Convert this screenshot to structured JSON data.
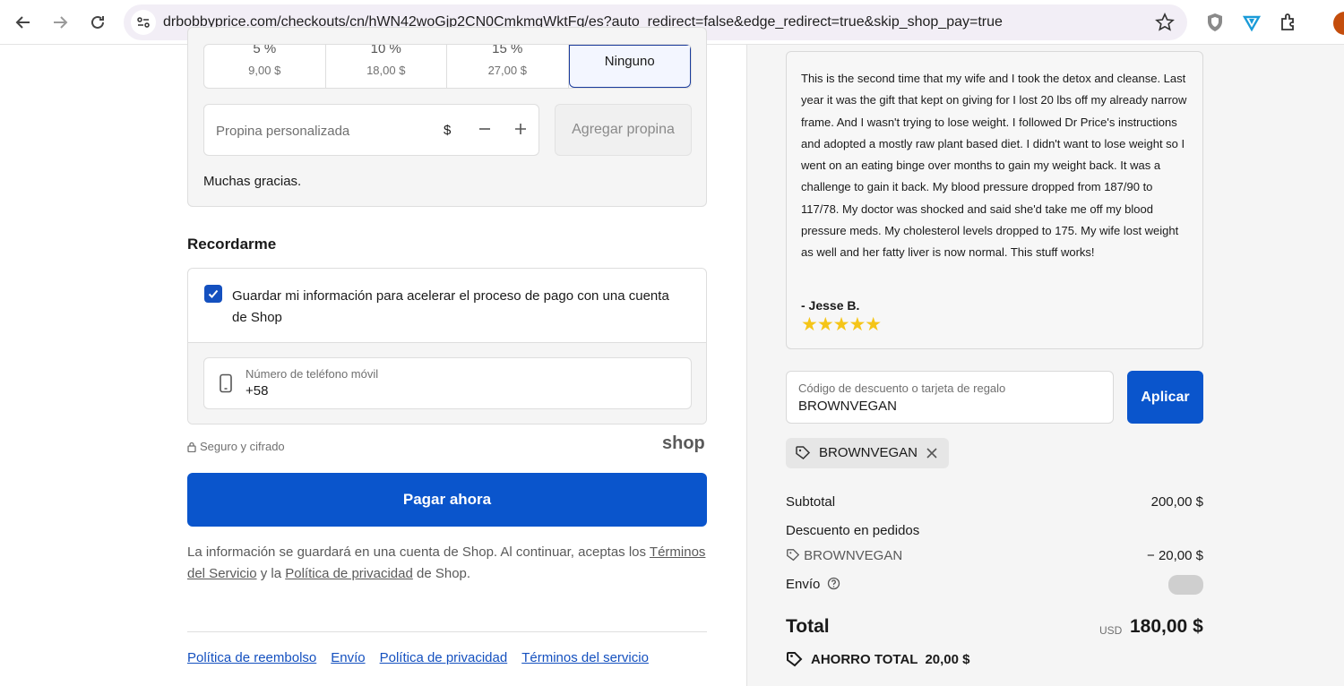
{
  "browser": {
    "url": "drbobbyprice.com/checkouts/cn/hWN42woGjp2CN0CmkmgWktFq/es?auto_redirect=false&edge_redirect=true&skip_shop_pay=true"
  },
  "tip": {
    "options": [
      {
        "pct": "5 %",
        "amount": "9,00 $"
      },
      {
        "pct": "10 %",
        "amount": "18,00 $"
      },
      {
        "pct": "15 %",
        "amount": "27,00 $"
      }
    ],
    "none_label": "Ninguno",
    "custom_placeholder": "Propina personalizada",
    "currency": "$",
    "add_label": "Agregar propina",
    "thanks": "Muchas gracias."
  },
  "remember": {
    "title": "Recordarme",
    "checkbox_label": "Guardar mi información para acelerar el proceso de pago con una cuenta de Shop",
    "phone_label": "Número de teléfono móvil",
    "phone_value": "+58",
    "secure": "Seguro y cifrado",
    "shop_logo": "shop"
  },
  "pay_label": "Pagar ahora",
  "disclaimer": {
    "text1": "La información se guardará en una cuenta de Shop. Al continuar, aceptas los ",
    "terms": "Términos del Servicio",
    "text2": " y la ",
    "privacy": "Política de privacidad",
    "text3": " de Shop."
  },
  "footer": {
    "refund": "Política de reembolso",
    "shipping": "Envío",
    "privacy": "Política de privacidad",
    "terms": "Términos del servicio"
  },
  "review": {
    "text": "This is the second time that my wife and I took the detox and cleanse. Last year it was the gift that kept on giving for I lost 20 lbs off my already narrow frame. And I wasn't trying to lose weight. I followed Dr Price's instructions and adopted a mostly raw plant based diet. I didn't want to lose weight so I went on an eating binge over months to gain my weight back. It was a challenge to gain it back. My blood pressure dropped from 187/90 to 117/78. My doctor was shocked and said she'd take me off my blood pressure meds. My cholesterol levels dropped to 175. My wife lost weight as well and her fatty liver is now normal. This stuff works!",
    "author": "- Jesse B.",
    "stars": "★★★★★",
    "rating": 5
  },
  "discount": {
    "label": "Código de descuento o tarjeta de regalo",
    "value": "BROWNVEGAN",
    "apply": "Aplicar",
    "chip": "BROWNVEGAN"
  },
  "summary": {
    "subtotal_label": "Subtotal",
    "subtotal_value": "200,00 $",
    "order_discount_label": "Descuento en pedidos",
    "code": "BROWNVEGAN",
    "discount_value": "− 20,00 $",
    "shipping_label": "Envío",
    "total_label": "Total",
    "total_currency": "USD",
    "total_value": "180,00 $",
    "saving_label": "AHORRO TOTAL",
    "saving_value": "20,00 $"
  }
}
